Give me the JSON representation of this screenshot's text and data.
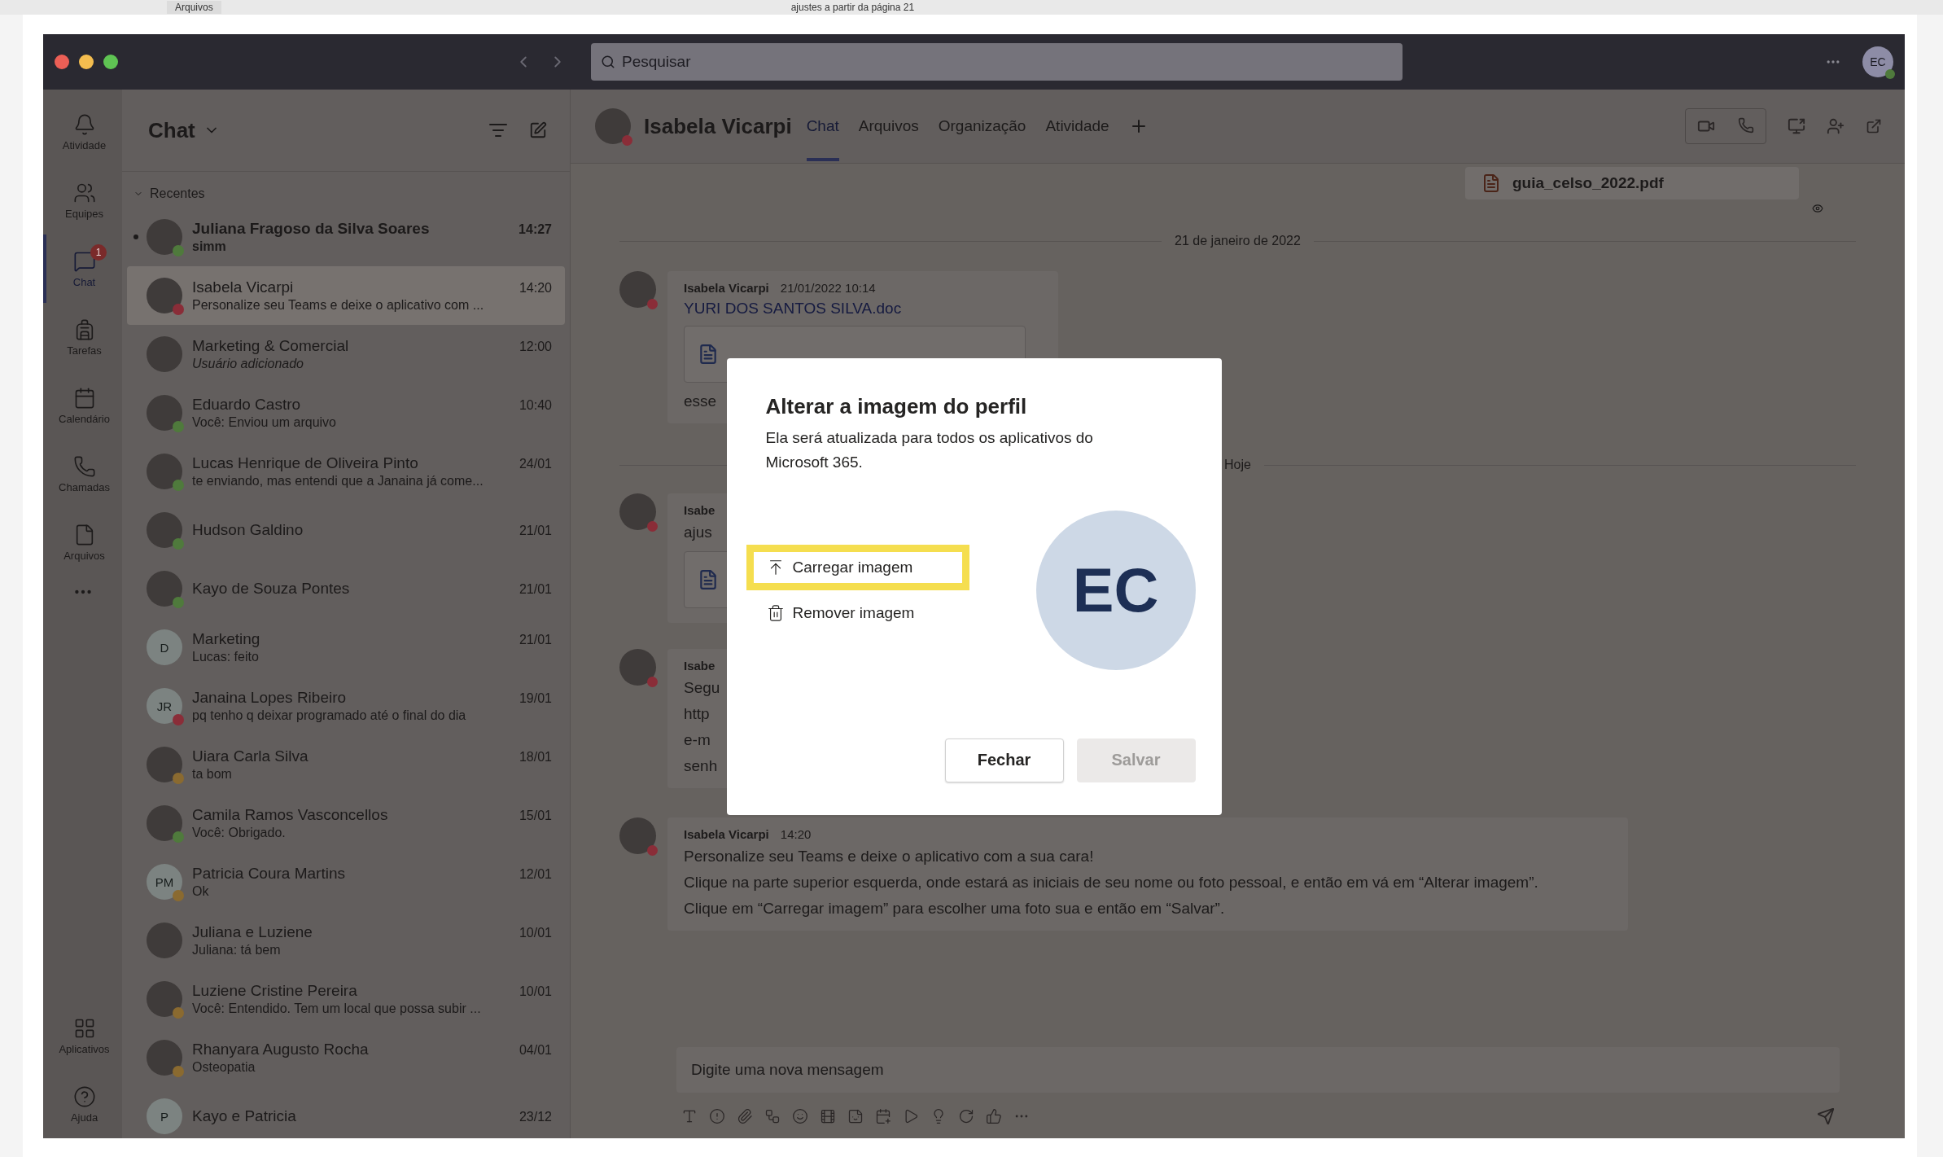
{
  "background": {
    "tab": "Arquivos",
    "text": "ajustes a partir da página 21"
  },
  "window": {
    "search_placeholder": "Pesquisar",
    "account_initials": "EC"
  },
  "rail": {
    "items": [
      {
        "label": "Atividade",
        "selected": false
      },
      {
        "label": "Equipes",
        "selected": false
      },
      {
        "label": "Chat",
        "selected": true,
        "badge": "1"
      },
      {
        "label": "Tarefas",
        "selected": false
      },
      {
        "label": "Calendário",
        "selected": false
      },
      {
        "label": "Chamadas",
        "selected": false
      },
      {
        "label": "Arquivos",
        "selected": false
      }
    ],
    "bottom_items": [
      {
        "label": "Aplicativos",
        "selected": false
      },
      {
        "label": "Ajuda",
        "selected": false
      }
    ]
  },
  "chat_list": {
    "title": "Chat",
    "section": "Recentes",
    "chats": [
      {
        "name": "Juliana Fragoso da Silva Soares",
        "preview": "simm",
        "time": "14:27",
        "unread": true,
        "selected": false,
        "italic": false,
        "color": "#4f7a3c"
      },
      {
        "name": "Isabela Vicarpi",
        "preview": "Personalize seu Teams e deixe o aplicativo com ...",
        "time": "14:20",
        "unread": false,
        "selected": true,
        "italic": false,
        "color": "#8a2d38"
      },
      {
        "name": "Marketing & Comercial",
        "preview": "Usuário adicionado",
        "time": "12:00",
        "unread": false,
        "selected": false,
        "italic": true
      },
      {
        "name": "Eduardo Castro",
        "preview": "Você: Enviou um arquivo",
        "time": "10:40",
        "unread": false,
        "selected": false,
        "italic": false,
        "color": "#4f7a3c"
      },
      {
        "name": "Lucas Henrique de Oliveira Pinto",
        "preview": "te enviando, mas entendi que a Janaina já come...",
        "time": "24/01",
        "unread": false,
        "selected": false,
        "italic": false,
        "color": "#4f7a3c"
      },
      {
        "name": "Hudson Galdino",
        "time": "21/01",
        "unread": false,
        "selected": false,
        "color": "#4f7a3c"
      },
      {
        "name": "Kayo de Souza Pontes",
        "time": "21/01",
        "unread": false,
        "selected": false,
        "color": "#4f7a3c"
      },
      {
        "name": "Marketing",
        "preview": "Lucas: feito",
        "time": "21/01",
        "unread": false,
        "selected": false,
        "italic": false,
        "initials": "D"
      },
      {
        "name": "Janaina Lopes Ribeiro",
        "preview": "pq tenho q deixar programado até o final do dia",
        "time": "19/01",
        "unread": false,
        "selected": false,
        "italic": false,
        "initials": "JR",
        "color": "#8a2d38"
      },
      {
        "name": "Uiara Carla Silva",
        "preview": "ta bom",
        "time": "18/01",
        "unread": false,
        "selected": false,
        "italic": false,
        "color": "#8a6a30"
      },
      {
        "name": "Camila Ramos Vasconcellos",
        "preview": "Você: Obrigado.",
        "time": "15/01",
        "unread": false,
        "selected": false,
        "italic": false,
        "color": "#4f7a3c"
      },
      {
        "name": "Patricia Coura Martins",
        "preview": "Ok",
        "time": "12/01",
        "unread": false,
        "selected": false,
        "italic": false,
        "initials": "PM",
        "color": "#8a6a30"
      },
      {
        "name": "Juliana e Luziene",
        "preview": "Juliana: tá bem",
        "time": "10/01",
        "unread": false,
        "selected": false,
        "italic": false
      },
      {
        "name": "Luziene Cristine Pereira",
        "preview": "Você: Entendido. Tem um local que possa subir ...",
        "time": "10/01",
        "unread": false,
        "selected": false,
        "italic": false,
        "color": "#8a6a30"
      },
      {
        "name": "Rhanyara Augusto Rocha",
        "preview": "Osteopatia",
        "time": "04/01",
        "unread": false,
        "selected": false,
        "italic": false,
        "color": "#8a6a30"
      },
      {
        "name": "Kayo e Patricia",
        "time": "23/12",
        "unread": false,
        "selected": false,
        "initials": "P"
      }
    ]
  },
  "conversation": {
    "name": "Isabela Vicarpi",
    "tabs": [
      {
        "label": "Chat",
        "selected": true
      },
      {
        "label": "Arquivos",
        "selected": false
      },
      {
        "label": "Organização",
        "selected": false
      },
      {
        "label": "Atividade",
        "selected": false
      }
    ],
    "items": [
      {
        "kind": "file",
        "name": "guia_celso_2022.pdf"
      },
      {
        "kind": "divider",
        "text": "21 de janeiro de 2022"
      },
      {
        "kind": "message",
        "author": "Isabela Vicarpi",
        "time": "21/01/2022 10:14",
        "link": "YURI DOS SANTOS SILVA.doc",
        "attachment": true,
        "lines": [
          "esse"
        ]
      },
      {
        "kind": "divider",
        "text": "Hoje"
      },
      {
        "kind": "partial",
        "author": "Isabe",
        "attachment": true,
        "lines": [
          "ajus"
        ]
      },
      {
        "kind": "partial",
        "author": "Isabe",
        "attachment": false,
        "lines": [
          "Segu",
          "http",
          "e-m",
          "senh"
        ]
      },
      {
        "kind": "message",
        "author": "Isabela Vicarpi",
        "time": "14:20",
        "attachment": false,
        "lines": [
          "Personalize seu Teams e deixe o aplicativo com a sua cara!",
          "Clique na parte superior esquerda, onde estará as iniciais de seu nome ou foto pessoal, e então em vá em “Alterar imagem”.",
          "Clique em “Carregar imagem” para escolher uma foto sua e então em “Salvar”."
        ]
      }
    ],
    "compose_placeholder": "Digite uma nova mensagem"
  },
  "dialog": {
    "title": "Alterar a imagem do perfil",
    "description": "Ela será atualizada para todos os aplicativos do Microsoft 365.",
    "options": [
      {
        "label": "Carregar imagem",
        "highlighted": true
      },
      {
        "label": "Remover imagem",
        "highlighted": false
      }
    ],
    "initials": "EC",
    "buttons": [
      {
        "label": "Fechar",
        "disabled": false
      },
      {
        "label": "Salvar",
        "disabled": true
      }
    ]
  }
}
